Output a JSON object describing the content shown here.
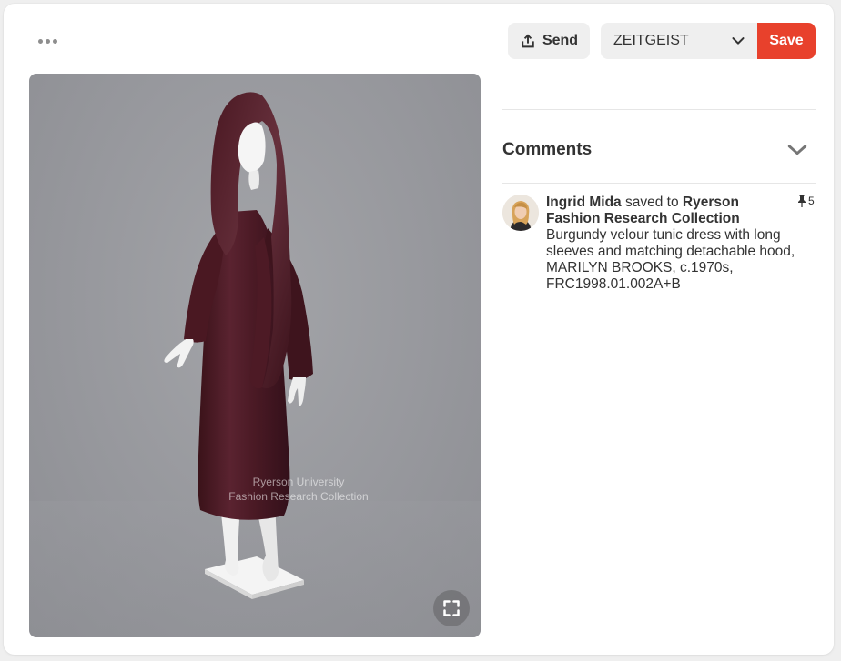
{
  "toolbar": {
    "more_icon": "ellipsis-icon",
    "send_label": "Send",
    "send_icon": "share-upload-icon",
    "board_name": "ZEITGEIST",
    "board_chevron_icon": "chevron-down-icon",
    "save_label": "Save",
    "save_color": "#e8412c"
  },
  "pin": {
    "watermark_line1": "Ryerson University",
    "watermark_line2": "Fashion Research Collection",
    "expand_icon": "expand-icon"
  },
  "comments": {
    "title": "Comments",
    "toggle_icon": "chevron-down-icon"
  },
  "activity": {
    "user": "Ingrid Mida",
    "action": "saved to",
    "board": "Ryerson Fashion Research Collection",
    "description": "Burgundy velour tunic dress with long sleeves and matching detachable hood, MARILYN BROOKS, c.1970s, FRC1998.01.002A+B",
    "pin_icon": "pushpin-icon",
    "pin_count": "5"
  }
}
